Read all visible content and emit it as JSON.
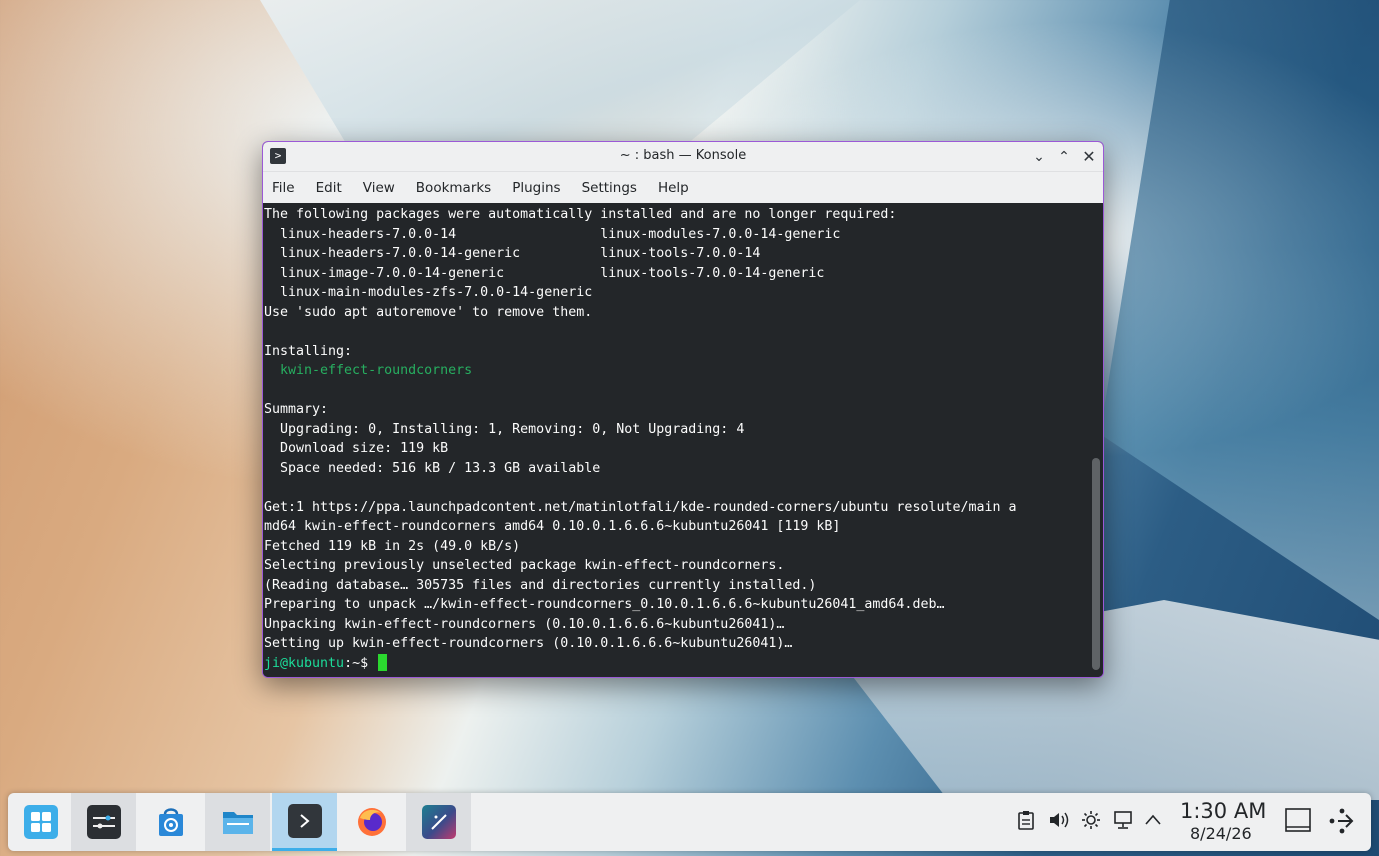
{
  "window": {
    "title": "~ : bash — Konsole",
    "app_icon": ">",
    "buttons": {
      "minimize": "⌄",
      "maximize": "⌃",
      "close": "✕"
    }
  },
  "menu": [
    "File",
    "Edit",
    "View",
    "Bookmarks",
    "Plugins",
    "Settings",
    "Help"
  ],
  "terminal": {
    "lines": [
      "The following packages were automatically installed and are no longer required:",
      "  linux-headers-7.0.0-14                  linux-modules-7.0.0-14-generic",
      "  linux-headers-7.0.0-14-generic          linux-tools-7.0.0-14",
      "  linux-image-7.0.0-14-generic            linux-tools-7.0.0-14-generic",
      "  linux-main-modules-zfs-7.0.0-14-generic",
      "Use 'sudo apt autoremove' to remove them.",
      "",
      "Installing:",
      "  kwin-effect-roundcorners",
      "",
      "Summary:",
      "  Upgrading: 0, Installing: 1, Removing: 0, Not Upgrading: 4",
      "  Download size: 119 kB",
      "  Space needed: 516 kB / 13.3 GB available",
      "",
      "Get:1 https://ppa.launchpadcontent.net/matinlotfali/kde-rounded-corners/ubuntu resolute/main a",
      "md64 kwin-effect-roundcorners amd64 0.10.0.1.6.6.6~kubuntu26041 [119 kB]",
      "Fetched 119 kB in 2s (49.0 kB/s)",
      "Selecting previously unselected package kwin-effect-roundcorners.",
      "(Reading database… 305735 files and directories currently installed.)",
      "Preparing to unpack …/kwin-effect-roundcorners_0.10.0.1.6.6.6~kubuntu26041_amd64.deb…",
      "Unpacking kwin-effect-roundcorners (0.10.0.1.6.6.6~kubuntu26041)…",
      "Setting up kwin-effect-roundcorners (0.10.0.1.6.6.6~kubuntu26041)…"
    ],
    "prompt": "ji@kubuntu",
    "prompt_suffix": ":~$"
  },
  "taskbar": {
    "apps": [
      "application-launcher-icon",
      "system-settings-icon",
      "discover-icon",
      "dolphin-icon",
      "konsole-icon",
      "firefox-icon",
      "kdenlive-icon"
    ],
    "time": "1:30 AM",
    "date": "8/24/26"
  },
  "colors": {
    "terminal_bg": "#232629",
    "package_highlight": "#27ae60",
    "prompt_green": "#1cdc9a",
    "window_border": "#9b59d6",
    "taskbar_active": "#b2d6ef"
  }
}
